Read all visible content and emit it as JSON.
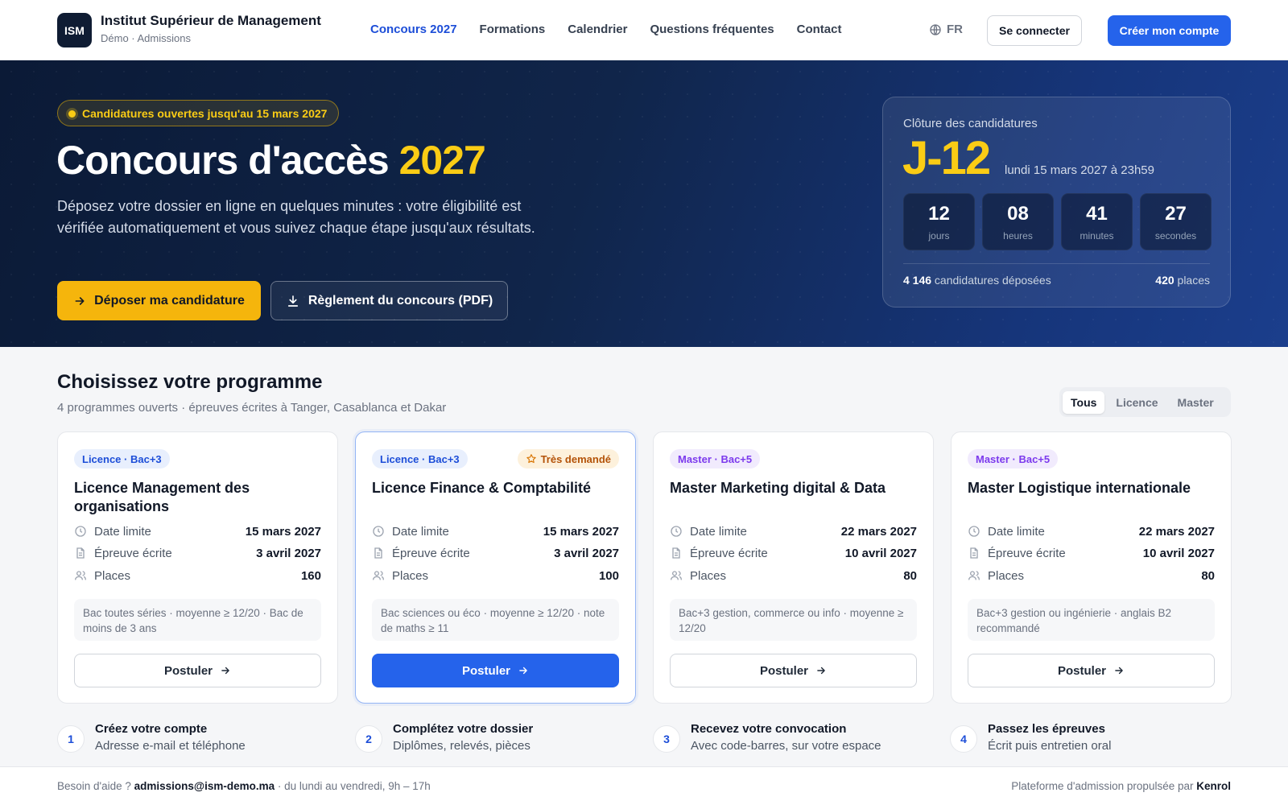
{
  "brand": {
    "logo": "ISM",
    "name": "Institut Supérieur de Management",
    "sub": "Démo · Admissions"
  },
  "nav": [
    {
      "label": "Concours 2027",
      "active": true
    },
    {
      "label": "Formations"
    },
    {
      "label": "Calendrier"
    },
    {
      "label": "Questions fréquentes"
    },
    {
      "label": "Contact"
    }
  ],
  "header": {
    "lang": "FR",
    "lang_icon": "globe-icon",
    "login": "Se connecter",
    "create": "Créer mon compte"
  },
  "colors": {
    "accent": "#2563eb",
    "hero_bg": "#0f1c33",
    "highlight": "#facc15",
    "cta": "#f5b50c"
  },
  "hero": {
    "pill": "Candidatures ouvertes jusqu'au 15 mars 2027",
    "title_main": "Concours d'accès ",
    "title_year": "2027",
    "lead": "Déposez votre dossier en ligne en quelques minutes : votre éligibilité est vérifiée automatiquement et vous suivez chaque étape jusqu'aux résultats.",
    "cta_primary": "Déposer ma candidature",
    "cta_secondary": "Règlement du concours (PDF)"
  },
  "countdown": {
    "label": "Clôture des candidatures",
    "big": "J-12",
    "date": "lundi 15 mars 2027 à 23h59",
    "units": [
      {
        "value": "12",
        "label": "jours"
      },
      {
        "value": "08",
        "label": "heures"
      },
      {
        "value": "41",
        "label": "minutes"
      },
      {
        "value": "27",
        "label": "secondes"
      }
    ],
    "applications_count": "4 146",
    "applications_label": " candidatures déposées",
    "places_count": "420",
    "places_label": " places"
  },
  "section": {
    "title": "Choisissez votre programme",
    "subtitle": "4 programmes ouverts · épreuves écrites à Tanger, Casablanca et Dakar"
  },
  "filters": [
    "Tous",
    "Licence",
    "Master"
  ],
  "labels": {
    "deadline": "Date limite",
    "exam": "Épreuve écrite",
    "places": "Places",
    "apply": "Postuler",
    "hot": "Très demandé"
  },
  "programs": [
    {
      "tag": "Licence · Bac+3",
      "level": "lic",
      "title": "Licence Management des organisations",
      "deadline": "15 mars 2027",
      "exam": "3 avril 2027",
      "places": "160",
      "requirements": "Bac toutes séries · moyenne ≥ 12/20 · Bac de moins de 3 ans",
      "featured": false
    },
    {
      "tag": "Licence · Bac+3",
      "level": "lic",
      "title": "Licence Finance & Comptabilité",
      "deadline": "15 mars 2027",
      "exam": "3 avril 2027",
      "places": "100",
      "requirements": "Bac sciences ou éco · moyenne ≥ 12/20 · note de maths ≥ 11",
      "featured": true
    },
    {
      "tag": "Master · Bac+5",
      "level": "mas",
      "title": "Master Marketing digital & Data",
      "deadline": "22 mars 2027",
      "exam": "10 avril 2027",
      "places": "80",
      "requirements": "Bac+3 gestion, commerce ou info · moyenne ≥ 12/20",
      "featured": false
    },
    {
      "tag": "Master · Bac+5",
      "level": "mas",
      "title": "Master Logistique internationale",
      "deadline": "22 mars 2027",
      "exam": "10 avril 2027",
      "places": "80",
      "requirements": "Bac+3 gestion ou ingénierie · anglais B2 recommandé",
      "featured": false
    }
  ],
  "steps": [
    {
      "n": "1",
      "title": "Créez votre compte",
      "sub": "Adresse e-mail et téléphone"
    },
    {
      "n": "2",
      "title": "Complétez votre dossier",
      "sub": "Diplômes, relevés, pièces"
    },
    {
      "n": "3",
      "title": "Recevez votre convocation",
      "sub": "Avec code-barres, sur votre espace"
    },
    {
      "n": "4",
      "title": "Passez les épreuves",
      "sub": "Écrit puis entretien oral"
    }
  ],
  "footer": {
    "help_prefix": "Besoin d'aide ? ",
    "email": "admissions@ism-demo.ma",
    "help_suffix": " · du lundi au vendredi, 9h – 17h",
    "powered": "Plateforme d'admission propulsée par ",
    "vendor": "Kenrol"
  }
}
